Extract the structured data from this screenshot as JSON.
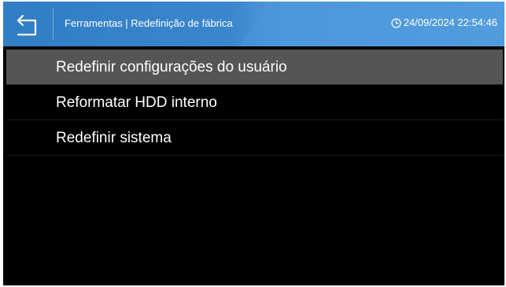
{
  "header": {
    "back_icon": "back-arrow-icon",
    "title": "Ferramentas | Redefinição de fábrica",
    "clock_icon": "clock-icon",
    "datetime": "24/09/2024 22:54:46",
    "colors": {
      "bar": "#3b86cc",
      "text": "#ffffff"
    }
  },
  "menu": {
    "items": [
      {
        "label": "Redefinir configurações do usuário",
        "selected": true
      },
      {
        "label": "Reformatar HDD interno",
        "selected": false
      },
      {
        "label": "Redefinir sistema",
        "selected": false
      }
    ],
    "colors": {
      "background": "#000000",
      "selected": "#555555",
      "text": "#ffffff"
    }
  }
}
